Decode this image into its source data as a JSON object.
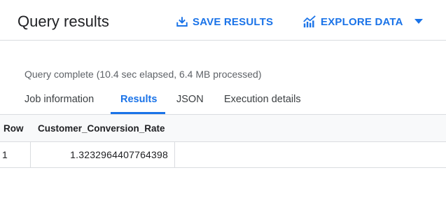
{
  "header": {
    "title": "Query results",
    "save_label": "SAVE RESULTS",
    "explore_label": "EXPLORE DATA",
    "accent_color": "#1a73e8"
  },
  "status": {
    "text": "Query complete (10.4 sec elapsed, 6.4 MB processed)"
  },
  "tabs": [
    {
      "label": "Job information",
      "active": false
    },
    {
      "label": "Results",
      "active": true
    },
    {
      "label": "JSON",
      "active": false
    },
    {
      "label": "Execution details",
      "active": false
    }
  ],
  "table": {
    "columns": [
      "Row",
      "Customer_Conversion_Rate"
    ],
    "rows": [
      [
        "1",
        "1.3232964407764398"
      ]
    ]
  },
  "icons": {
    "save": "download-icon",
    "explore": "chart-icon",
    "caret": "caret-down-icon"
  }
}
